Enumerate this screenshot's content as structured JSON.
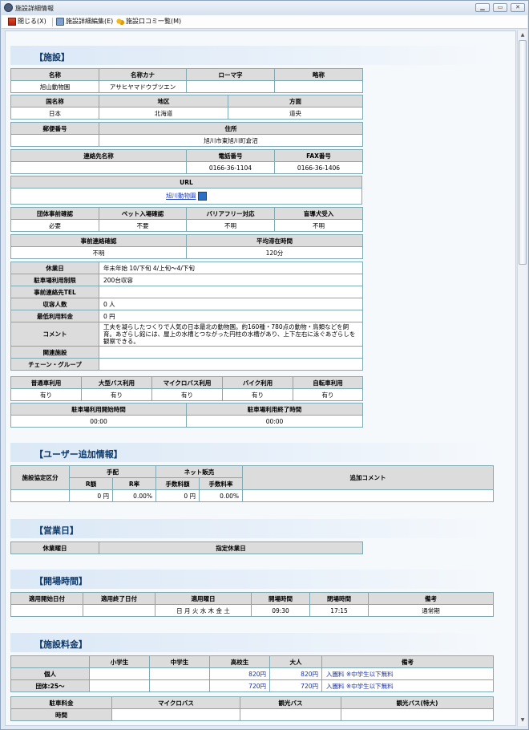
{
  "window": {
    "title": "施設詳細情報"
  },
  "toolbar": {
    "close": "閉じる(X)",
    "edit": "施設詳細編集(E)",
    "reviews": "施設口コミ一覧(M)"
  },
  "facility": {
    "section": "【施設】",
    "name_h": "名称",
    "kana_h": "名称カナ",
    "roman_h": "ローマ字",
    "abbr_h": "略称",
    "name": "旭山動物園",
    "kana": "アサヒヤマドウブツエン",
    "roman": "",
    "abbr": "",
    "country_h": "国名称",
    "region_h": "地区",
    "direction_h": "方面",
    "country": "日本",
    "region": "北海道",
    "direction": "道央",
    "zip_h": "郵便番号",
    "addr_h": "住所",
    "zip": "",
    "addr": "旭川市東旭川町倉沼",
    "contact_h": "連絡先名称",
    "tel_h": "電話番号",
    "fax_h": "FAX番号",
    "contact": "",
    "tel": "0166-36-1104",
    "fax": "0166-36-1406",
    "url_h": "URL",
    "url": "旭川動物園",
    "group_h": "団体事前確認",
    "pet_h": "ペット入場確認",
    "barrier_h": "バリアフリー対応",
    "dog_h": "盲導犬受入",
    "group": "必要",
    "pet": "不要",
    "barrier": "不明",
    "dog": "不明",
    "advance_h": "事前連絡確認",
    "stay_h": "平均滞在時間",
    "advance": "不明",
    "stay": "120分",
    "closed_h": "休業日",
    "closed": "年末年始 10/下旬 4/上旬〜4/下旬",
    "parking_limit_h": "駐車場利用制限",
    "parking_limit": "200台収容",
    "pretel_h": "事前連絡先TEL",
    "pretel": "",
    "capacity_h": "収容人数",
    "capacity": "0 人",
    "minfee_h": "最低利用料金",
    "minfee": "0 円",
    "comment_h": "コメント",
    "comment": "工夫を凝らしたつくりで人気の日本最北の動物園。約160種・780点の動物・鳥類などを飼育。あざらし館には、屋上の水槽とつながった円柱の水槽があり、上下左右に泳ぐあざらしを観察できる。",
    "related_h": "関連施設",
    "related": "",
    "chain_h": "チェーン・グループ",
    "chain": "",
    "car_h": "普通車利用",
    "bus_h": "大型バス利用",
    "micro_h": "マイクロバス利用",
    "bike_h": "バイク利用",
    "cycle_h": "自転車利用",
    "car": "有り",
    "bus": "有り",
    "micro": "有り",
    "bike": "有り",
    "cycle": "有り",
    "pstart_h": "駐車場利用開始時間",
    "pend_h": "駐車場利用終了時間",
    "pstart": "00:00",
    "pend": "00:00"
  },
  "user_info": {
    "section": "【ユーザー追加情報】",
    "cat_h": "施設協定区分",
    "arr_h": "手配",
    "net_h": "ネット販売",
    "comment_h": "追加コメント",
    "r_amount_h": "R額",
    "r_rate_h": "R率",
    "fee_amount_h": "手数料額",
    "fee_rate_h": "手数料率",
    "r_amount": "0 円",
    "r_rate": "0.00%",
    "fee_amount": "0 円",
    "fee_rate": "0.00%"
  },
  "business_days": {
    "section": "【営業日】",
    "weekday_h": "休業曜日",
    "specified_h": "指定休業日"
  },
  "hours": {
    "section": "【開場時間】",
    "start_h": "適用開始日付",
    "end_h": "適用終了日付",
    "days_h": "適用曜日",
    "open_h": "開場時間",
    "close_h": "閉場時間",
    "note_h": "備考",
    "start": "",
    "end": "",
    "days": "日 月 火 水 木 金 土",
    "open": "09:30",
    "close": "17:15",
    "note": "通常期"
  },
  "fees": {
    "section": "【施設料金】",
    "elem_h": "小学生",
    "jh_h": "中学生",
    "hs_h": "高校生",
    "adult_h": "大人",
    "note_h": "備考",
    "rows": [
      {
        "label": "個人",
        "hs": "820円",
        "adult": "820円",
        "note": "入園料 ※中学生以下無料"
      },
      {
        "label": "団体:25〜",
        "hs": "720円",
        "adult": "720円",
        "note": "入園料 ※中学生以下無料"
      }
    ],
    "parking_h": "駐車料金",
    "micro_h": "マイクロバス",
    "tour_h": "観光バス",
    "tour_l_h": "観光バス(特大)",
    "time_h": "時間"
  }
}
